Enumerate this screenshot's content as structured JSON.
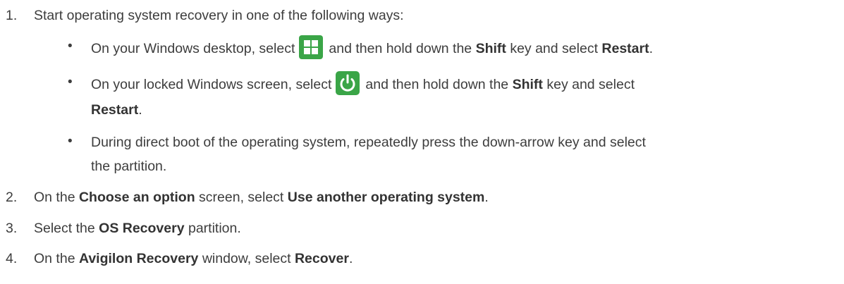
{
  "steps": [
    {
      "num": "1.",
      "text": "Start operating system recovery in one of the following ways:",
      "bullets": [
        {
          "pre": "On your Windows desktop, select",
          "icon": "windows-logo-icon",
          "mid": "and then hold down the",
          "b1": "Shift",
          "mid2": "key and select",
          "b2": "Restart",
          "end": "."
        },
        {
          "pre": "On your locked Windows screen, select",
          "icon": "power-icon",
          "mid": "and then hold down the",
          "b1": "Shift",
          "mid2": "key and select",
          "b2": "Restart",
          "end": "."
        },
        {
          "line1": "During direct boot of the operating system, repeatedly press the down-arrow key and select",
          "line2": "the partition."
        }
      ]
    },
    {
      "num": "2.",
      "pre": "On the",
      "b1": "Choose an option",
      "mid": "screen, select",
      "b2": "Use another operating system",
      "end": "."
    },
    {
      "num": "3.",
      "pre": "Select the",
      "b1": "OS Recovery",
      "end": "partition."
    },
    {
      "num": "4.",
      "pre": "On the",
      "b1": "Avigilon Recovery",
      "mid": "window, select",
      "b2": "Recover",
      "end": "."
    }
  ],
  "colors": {
    "icon_bg": "#3aa547",
    "text": "#3d3d3d"
  }
}
